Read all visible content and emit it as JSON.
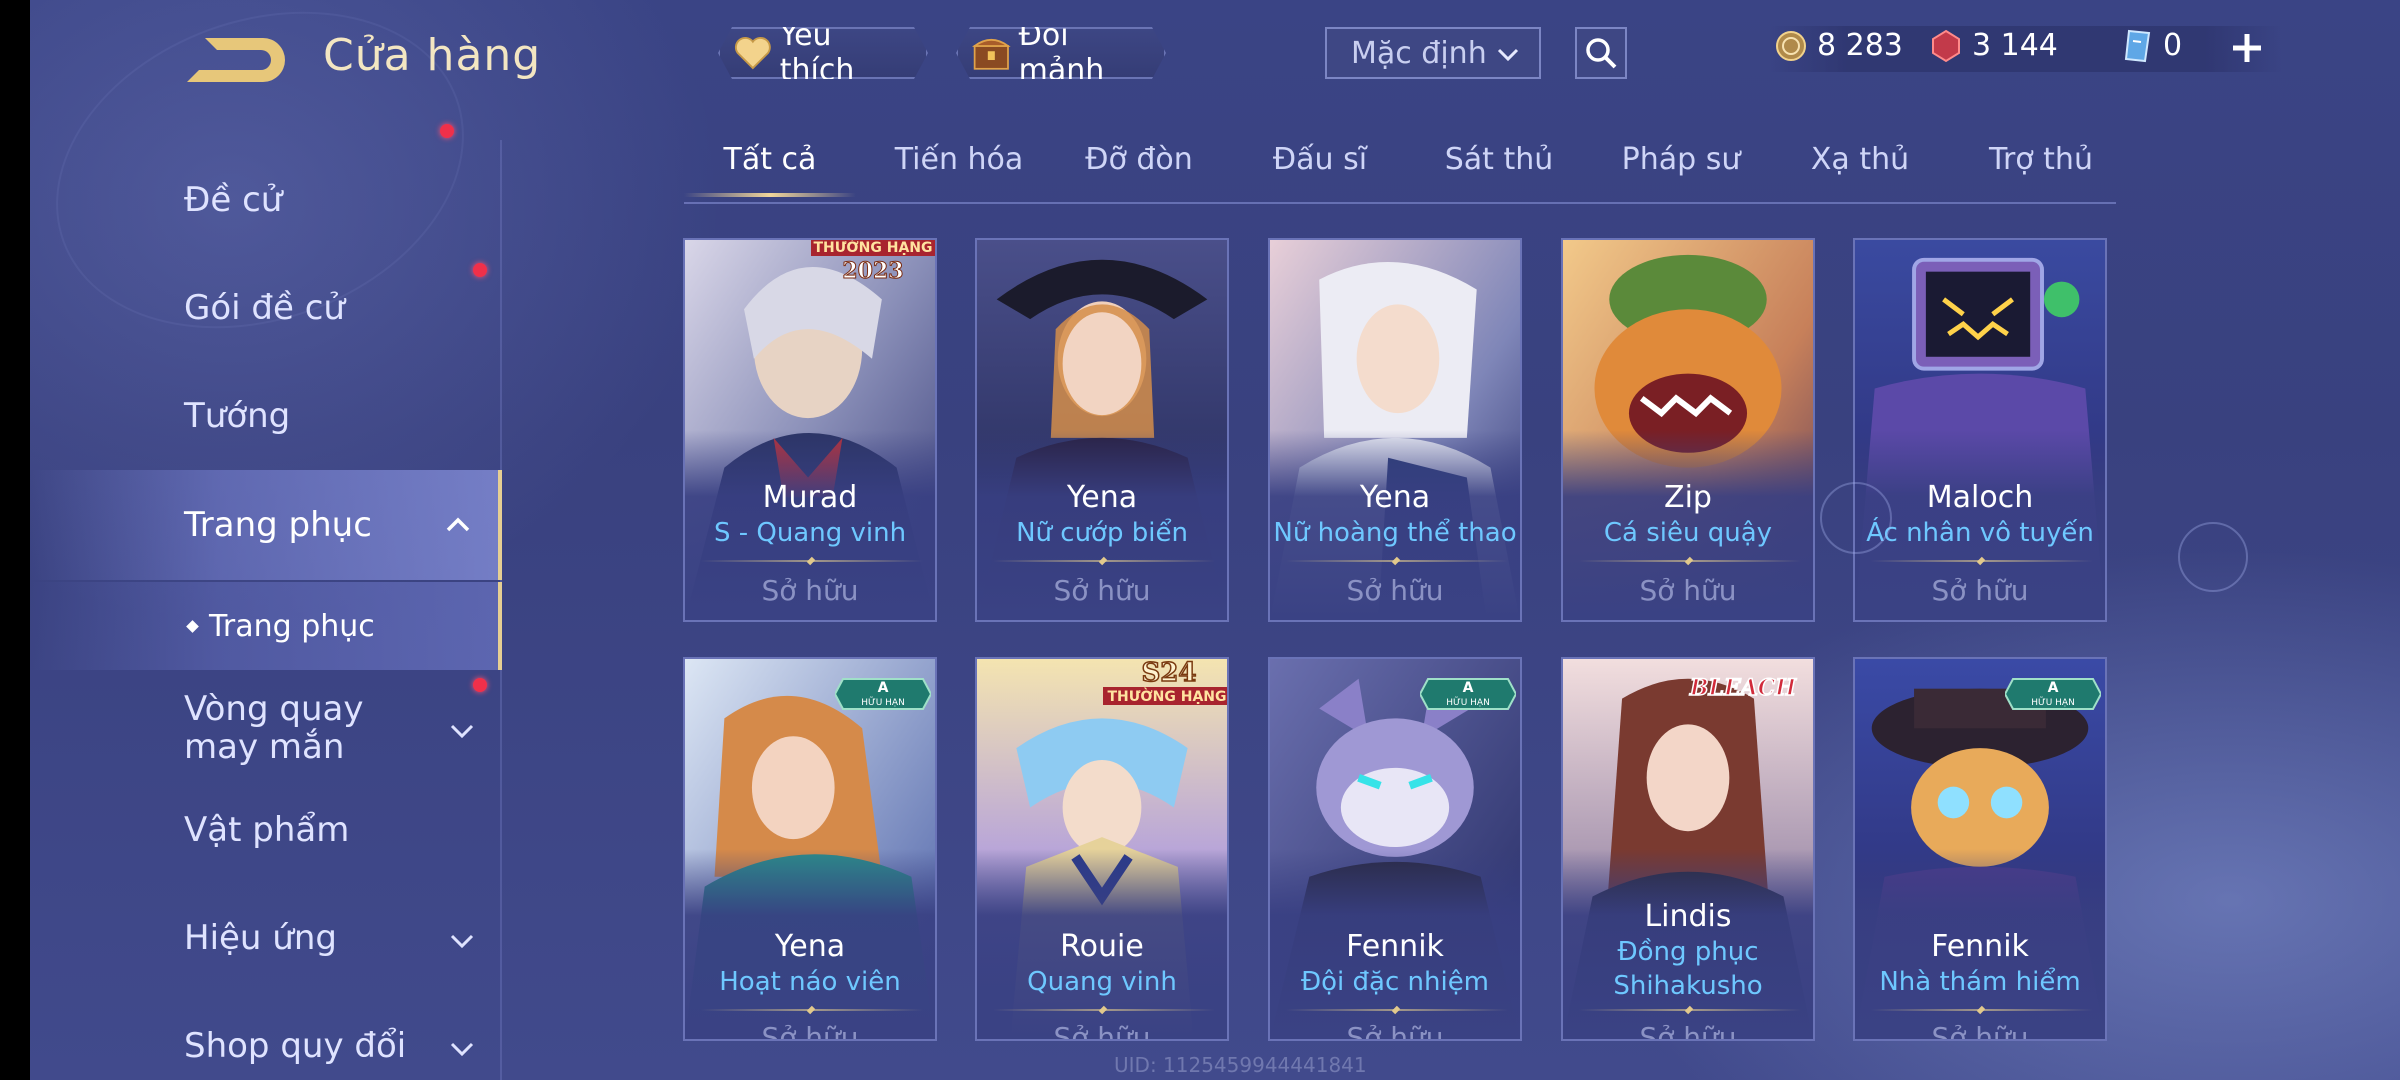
{
  "header": {
    "title": "Cửa hàng",
    "favorites_label": "Yêu thích",
    "shard_exchange_label": "Đổi mảnh",
    "sort_value": "Mặc định",
    "currencies": [
      {
        "name": "gold-coin",
        "value": "8 283"
      },
      {
        "name": "ruby",
        "value": "3 144"
      },
      {
        "name": "voucher",
        "value": "0"
      }
    ]
  },
  "sidebar": {
    "items": [
      {
        "label": "Đề cử"
      },
      {
        "label": "Gói đề cử"
      },
      {
        "label": "Tướng"
      },
      {
        "label": "Trang phục"
      },
      {
        "label": "Vòng quay may mắn"
      },
      {
        "label": "Vật phẩm"
      },
      {
        "label": "Hiệu ứng"
      },
      {
        "label": "Shop quy đổi"
      }
    ],
    "sub_item": "Trang phục"
  },
  "tabs": [
    "Tất cả",
    "Tiến hóa",
    "Đỡ đòn",
    "Đấu sĩ",
    "Sát thủ",
    "Pháp sư",
    "Xạ thủ",
    "Trợ thủ"
  ],
  "cards": [
    {
      "hero": "Murad",
      "skin": "S - Quang vinh",
      "status": "Sở hữu",
      "badge": "THƯỜNG HẠNG 2023"
    },
    {
      "hero": "Yena",
      "skin": "Nữ cướp biển",
      "status": "Sở hữu"
    },
    {
      "hero": "Yena",
      "skin": "Nữ hoàng thể thao",
      "status": "Sở hữu"
    },
    {
      "hero": "Zip",
      "skin": "Cá siêu quậy",
      "status": "Sở hữu"
    },
    {
      "hero": "Maloch",
      "skin": "Ác nhân vô tuyến",
      "status": "Sở hữu"
    },
    {
      "hero": "Yena",
      "skin": "Hoạt náo viên",
      "status": "Sở hữu",
      "badge": "A HỮU HẠN"
    },
    {
      "hero": "Rouie",
      "skin": "Quang vinh",
      "status": "Sở hữu",
      "badge": "S24 THƯỜNG HẠNG"
    },
    {
      "hero": "Fennik",
      "skin": "Đội đặc nhiệm",
      "status": "Sở hữu",
      "badge": "A HỮU HẠN"
    },
    {
      "hero": "Lindis",
      "skin": "Đồng phục Shihakusho",
      "status": "Sở hữu",
      "badge": "BLEACH"
    },
    {
      "hero": "Fennik",
      "skin": "Nhà thám hiểm",
      "status": "Sở hữu",
      "badge": "A HỮU HẠN"
    }
  ],
  "footer": {
    "uid": "UID: 1125459944441841"
  },
  "colors": {
    "accent_gold": "#e6cf93",
    "skin_name_blue": "#6ec8ff",
    "notification_red": "#f0304a"
  }
}
